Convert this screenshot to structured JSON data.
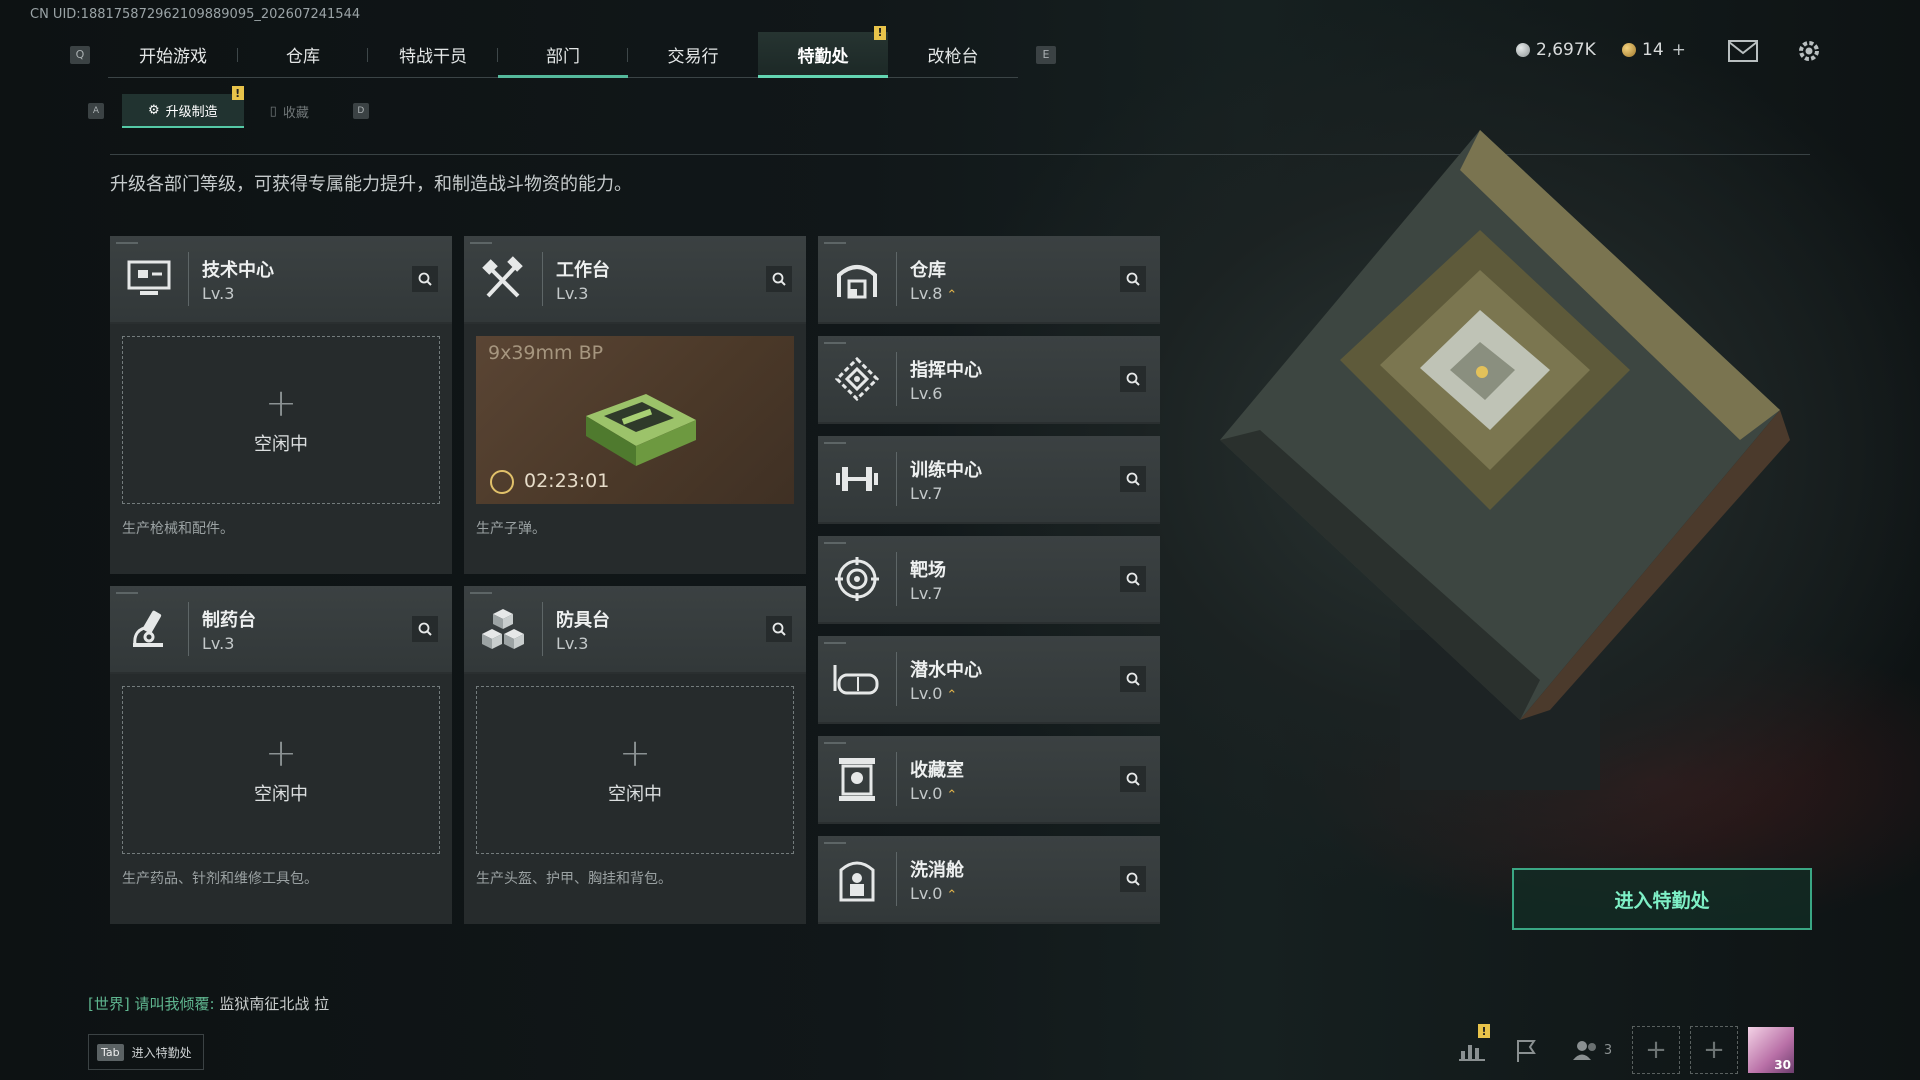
{
  "uid_text": "CN UID:188175872962109889095_202607241544",
  "top_nav": {
    "key_left": "Q",
    "key_right": "E",
    "tabs": [
      "开始游戏",
      "仓库",
      "特战干员",
      "部门",
      "交易行",
      "特勤处",
      "改枪台"
    ],
    "active_tab": "特勤处",
    "alert_badge": "!"
  },
  "currency": {
    "coins": "2,697K",
    "tickets": "14",
    "add_symbol": "+",
    "coin_color": "#b9bfc0",
    "ticket_color": "#d9b252"
  },
  "sub_nav": {
    "key_left": "A",
    "key_right": "D",
    "tabs": [
      "升级制造",
      "收藏"
    ],
    "active": "升级制造",
    "alert_badge": "!"
  },
  "description": "升级各部门等级，可获得专属能力提升，和制造战斗物资的能力。",
  "workshops": [
    {
      "name": "技术中心",
      "level": "Lv.3",
      "icon": "monitor-icon",
      "status": "空闲中",
      "desc": "生产枪械和配件。"
    },
    {
      "name": "工作台",
      "level": "Lv.3",
      "icon": "tools-icon",
      "job": {
        "item": "9x39mm BP",
        "timer": "02:23:01"
      },
      "desc": "生产子弹。"
    },
    {
      "name": "制药台",
      "level": "Lv.3",
      "icon": "microscope-icon",
      "status": "空闲中",
      "desc": "生产药品、针剂和维修工具包。"
    },
    {
      "name": "防具台",
      "level": "Lv.3",
      "icon": "cubes-icon",
      "status": "空闲中",
      "desc": "生产头盔、护甲、胸挂和背包。"
    }
  ],
  "facilities": [
    {
      "name": "仓库",
      "level": "Lv.8",
      "upgradable": true,
      "icon": "warehouse-icon"
    },
    {
      "name": "指挥中心",
      "level": "Lv.6",
      "upgradable": false,
      "icon": "command-icon"
    },
    {
      "name": "训练中心",
      "level": "Lv.7",
      "upgradable": false,
      "icon": "dumbbell-icon"
    },
    {
      "name": "靶场",
      "level": "Lv.7",
      "upgradable": false,
      "icon": "target-icon"
    },
    {
      "name": "潜水中心",
      "level": "Lv.0",
      "upgradable": true,
      "icon": "diving-mask-icon"
    },
    {
      "name": "收藏室",
      "level": "Lv.0",
      "upgradable": true,
      "icon": "collection-icon"
    },
    {
      "name": "洗消舱",
      "level": "Lv.0",
      "upgradable": true,
      "icon": "decon-icon"
    }
  ],
  "plus_symbol": "+",
  "enter_button": "进入特勤处",
  "chat": {
    "channel": "[世界]",
    "user": "请叫我倾覆:",
    "message": "监狱南征北战 拉"
  },
  "tab_hint": {
    "key": "Tab",
    "label": "进入特勤处"
  },
  "bottom": {
    "party_count": "3",
    "avatar_level": "30",
    "alert_badge": "!"
  }
}
